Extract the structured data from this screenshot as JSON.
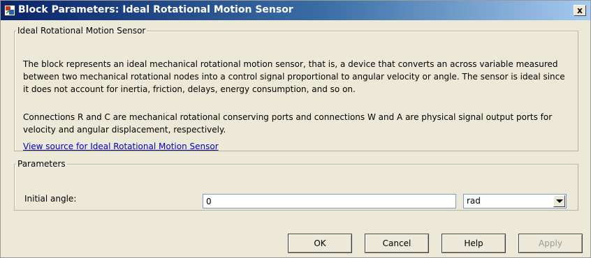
{
  "window": {
    "title": "Block Parameters: Ideal Rotational Motion Sensor",
    "close_label": "x"
  },
  "description": {
    "group_title": "Ideal Rotational Motion Sensor",
    "paragraph1": "The block represents an ideal mechanical rotational motion sensor, that is, a device that converts an across variable measured between two mechanical rotational nodes into a control signal proportional to angular velocity or angle. The sensor is ideal since it does not account for inertia, friction, delays, energy consumption, and so on.",
    "paragraph2": "Connections R and C are mechanical rotational conserving ports and connections W and A are physical signal output ports for velocity and angular displacement, respectively.",
    "source_link": "View source for Ideal Rotational Motion Sensor"
  },
  "parameters": {
    "group_title": "Parameters",
    "initial_angle": {
      "label": "Initial angle:",
      "value": "0",
      "unit": "rad"
    }
  },
  "buttons": {
    "ok": "OK",
    "cancel": "Cancel",
    "help": "Help",
    "apply": "Apply"
  },
  "colors": {
    "title_gradient_start": "#0a246a",
    "title_gradient_end": "#a6caf0",
    "link": "#0000c0",
    "dialog_background": "#ece9d8"
  },
  "icons": {
    "app": "simulink-block-icon",
    "close": "close-icon",
    "dropdown": "chevron-down-icon"
  }
}
